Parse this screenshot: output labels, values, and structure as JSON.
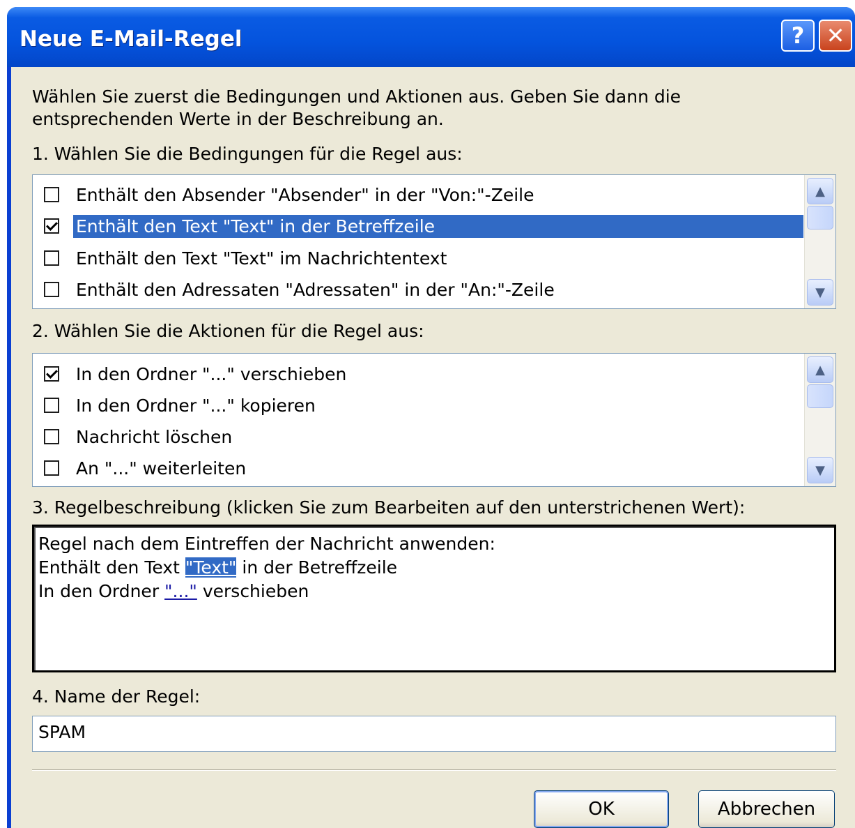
{
  "window": {
    "title": "Neue E-Mail-Regel",
    "help_label": "?",
    "close_label": "✕"
  },
  "intro": {
    "line1": "Wählen Sie zuerst die Bedingungen und Aktionen aus. Geben Sie dann die",
    "line2": "entsprechenden Werte in der Beschreibung an."
  },
  "conditions": {
    "heading": "1. Wählen Sie die Bedingungen für die Regel aus:",
    "items": [
      {
        "label": "Enthält den Absender \"Absender\" in der \"Von:\"-Zeile",
        "checked": false,
        "selected": false
      },
      {
        "label": "Enthält den Text \"Text\" in der Betreffzeile",
        "checked": true,
        "selected": true
      },
      {
        "label": "Enthält den Text \"Text\" im Nachrichtentext",
        "checked": false,
        "selected": false
      },
      {
        "label": "Enthält den Adressaten \"Adressaten\" in der \"An:\"-Zeile",
        "checked": false,
        "selected": false
      }
    ]
  },
  "actions": {
    "heading": "2. Wählen Sie die Aktionen für die Regel aus:",
    "items": [
      {
        "label": "In den Ordner \"...\" verschieben",
        "checked": true,
        "selected": false
      },
      {
        "label": "In den Ordner \"...\" kopieren",
        "checked": false,
        "selected": false
      },
      {
        "label": "Nachricht löschen",
        "checked": false,
        "selected": false
      },
      {
        "label": "An \"...\" weiterleiten",
        "checked": false,
        "selected": false
      }
    ]
  },
  "description": {
    "heading": "3. Regelbeschreibung (klicken Sie zum Bearbeiten auf den unterstrichenen Wert):",
    "line1": "Regel nach dem Eintreffen der Nachricht anwenden:",
    "line2_pre": "Enthält den Text ",
    "line2_link": "\"Text\"",
    "line2_post": " in der Betreffzeile",
    "line3_pre": "In den Ordner ",
    "line3_link": "\"...\"",
    "line3_post": " verschieben"
  },
  "name": {
    "heading": "4. Name der Regel:",
    "value": "SPAM"
  },
  "buttons": {
    "ok": "OK",
    "cancel": "Abbrechen"
  },
  "icons": {
    "scroll_up": "chevron-up-icon",
    "scroll_down": "chevron-down-icon"
  }
}
